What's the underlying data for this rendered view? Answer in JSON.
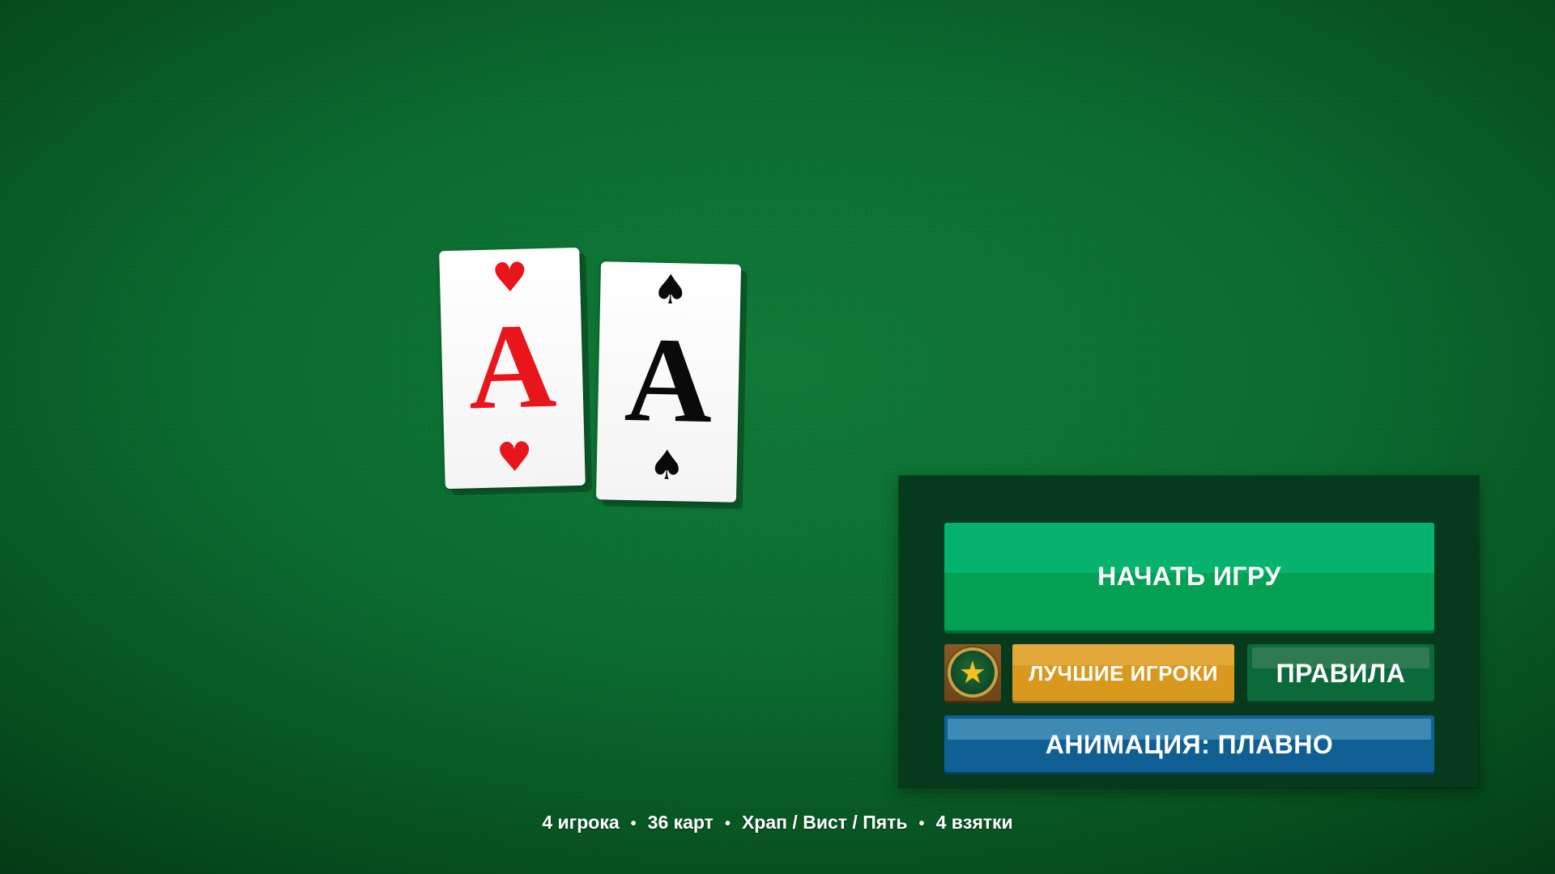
{
  "cards": [
    {
      "rank": "A",
      "suit_symbol": "♥",
      "suit": "hearts",
      "color": "#e8151b"
    },
    {
      "rank": "A",
      "suit_symbol": "♠",
      "suit": "spades",
      "color": "#0a0a0a"
    }
  ],
  "menu": {
    "start_label": "НАЧАТЬ ИГРУ",
    "leaders_icon": "star-medal-icon",
    "leaders_label": "ЛУЧШИЕ ИГРОКИ",
    "rules_label": "ПРАВИЛА",
    "animation_label": "АНИМАЦИЯ: ПЛАВНО"
  },
  "info": {
    "players": "4 игрока",
    "cards": "36 карт",
    "modes": "Храп / Вист / Пять",
    "tricks": "4 взятки",
    "separator": "•"
  },
  "colors": {
    "table_green": "#0b6b2f",
    "start_button": "#04a054",
    "leaders_button": "#d9991e",
    "rules_button": "#0a6a3b",
    "animation_button": "#0f5f95",
    "panel": "#07391c"
  }
}
